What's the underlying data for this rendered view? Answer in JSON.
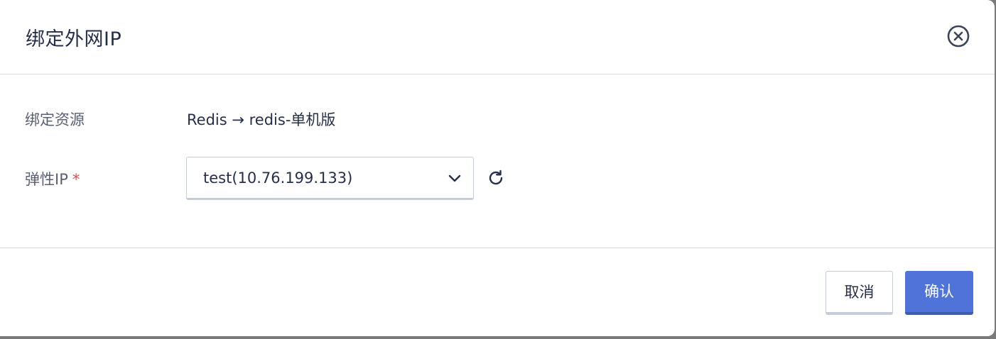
{
  "dialog": {
    "title": "绑定外网IP",
    "close_icon": "close-circle-icon"
  },
  "form": {
    "resource_label": "绑定资源",
    "resource_value": "Redis → redis-单机版",
    "eip_label": "弹性IP",
    "required_mark": "*",
    "eip_selected": "test(10.76.199.133)",
    "chevron_icon": "chevron-down-icon",
    "refresh_icon": "refresh-icon"
  },
  "footer": {
    "cancel_label": "取消",
    "confirm_label": "确认"
  },
  "colors": {
    "primary": "#4f73d9",
    "title_text": "#262f4a",
    "label_text": "#5b6072",
    "required": "#e5464b",
    "border": "#c7ccd8"
  }
}
